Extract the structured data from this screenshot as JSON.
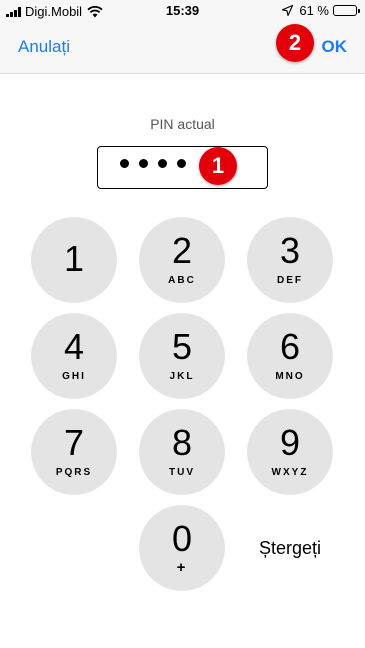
{
  "status_bar": {
    "carrier": "Digi.Mobil",
    "time": "15:39",
    "battery": "61 %",
    "battery_level": 0.61,
    "icons": [
      "signal-bars-icon",
      "wifi-icon",
      "location-arrow-icon",
      "battery-icon"
    ]
  },
  "nav": {
    "cancel_label": "Anulați",
    "ok_label": "OK",
    "accent_color": "#1d7cf2"
  },
  "annotations": {
    "marker_1": "1",
    "marker_2": "2",
    "marker_color": "#e3000b"
  },
  "pin": {
    "label": "PIN actual",
    "entered_digits": 4
  },
  "keypad": {
    "keys": [
      {
        "digit": "1",
        "letters": ""
      },
      {
        "digit": "2",
        "letters": "ABC"
      },
      {
        "digit": "3",
        "letters": "DEF"
      },
      {
        "digit": "4",
        "letters": "GHI"
      },
      {
        "digit": "5",
        "letters": "JKL"
      },
      {
        "digit": "6",
        "letters": "MNO"
      },
      {
        "digit": "7",
        "letters": "PQRS"
      },
      {
        "digit": "8",
        "letters": "TUV"
      },
      {
        "digit": "9",
        "letters": "WXYZ"
      },
      {
        "digit": "0",
        "letters": "+"
      }
    ],
    "delete_label": "Ștergeți",
    "key_color": "#e4e4e4"
  }
}
